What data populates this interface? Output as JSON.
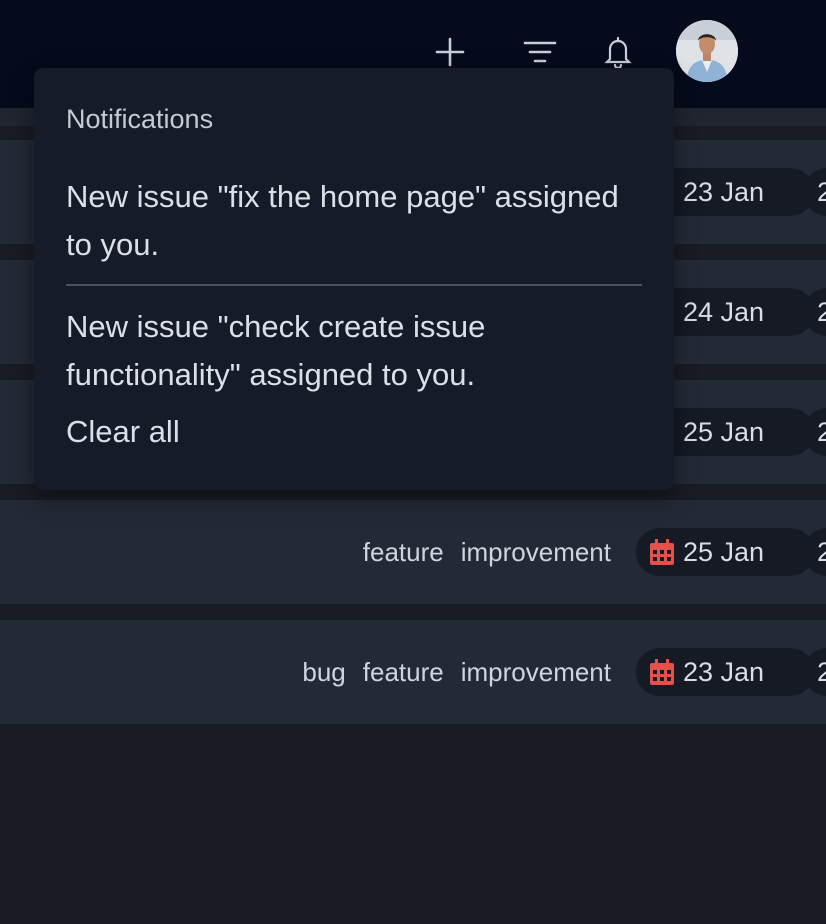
{
  "topbar": {
    "icons": [
      "plus-icon",
      "filter-icon",
      "bell-icon"
    ],
    "avatar": "user-avatar"
  },
  "issues": [
    {
      "labels": [],
      "date": "23 Jan"
    },
    {
      "labels": [],
      "date": "24 Jan"
    },
    {
      "labels": [],
      "date": "25 Jan"
    },
    {
      "labels": [
        "feature",
        "improvement"
      ],
      "date": "25 Jan"
    },
    {
      "labels": [
        "bug",
        "feature",
        "improvement"
      ],
      "date": "23 Jan"
    }
  ],
  "notifications": {
    "title": "Notifications",
    "items": [
      "New issue \"fix the home page\" assigned to you.",
      "New issue \"check create issue functionality\" assigned to you."
    ],
    "clear_label": "Clear all"
  },
  "colors": {
    "calendar_icon": "#e0524a",
    "topbar_bg": "#050a1c",
    "row_bg": "#232a37",
    "dropdown_bg": "#151b28"
  },
  "truncated_next_column_glyph": "2"
}
